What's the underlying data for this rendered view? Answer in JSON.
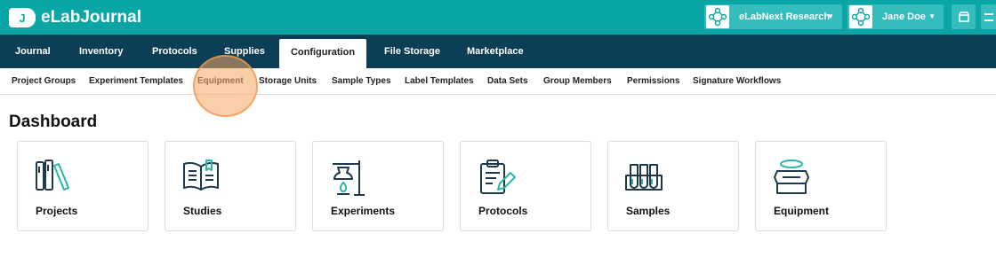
{
  "app": {
    "logo_badge": "J",
    "title": "eLabJournal"
  },
  "accounts": {
    "organization": "eLabNext Research",
    "user": "Jane Doe"
  },
  "main_nav": {
    "tabs": [
      {
        "label": "Journal"
      },
      {
        "label": "Inventory"
      },
      {
        "label": "Protocols"
      },
      {
        "label": "Supplies"
      },
      {
        "label": "Configuration",
        "active": true
      },
      {
        "label": "File Storage"
      },
      {
        "label": "Marketplace"
      }
    ]
  },
  "sub_nav": {
    "items": [
      {
        "label": "Project Groups"
      },
      {
        "label": "Experiment Templates"
      },
      {
        "label": "Equipment",
        "active": true
      },
      {
        "label": "Storage Units"
      },
      {
        "label": "Sample Types"
      },
      {
        "label": "Label Templates"
      },
      {
        "label": "Data Sets"
      },
      {
        "label": "Group Members"
      },
      {
        "label": "Permissions"
      },
      {
        "label": "Signature Workflows"
      }
    ]
  },
  "dashboard": {
    "title": "Dashboard",
    "cards": [
      {
        "label": "Projects",
        "icon": "projects-icon"
      },
      {
        "label": "Studies",
        "icon": "studies-icon"
      },
      {
        "label": "Experiments",
        "icon": "experiments-icon"
      },
      {
        "label": "Protocols",
        "icon": "protocols-icon"
      },
      {
        "label": "Samples",
        "icon": "samples-icon"
      },
      {
        "label": "Equipment",
        "icon": "equipment-icon"
      }
    ]
  },
  "colors": {
    "topbar": "#0aa6a6",
    "mainnav": "#0c3e56",
    "icon_dark": "#1e3a4a",
    "icon_accent": "#2bb5a8"
  }
}
